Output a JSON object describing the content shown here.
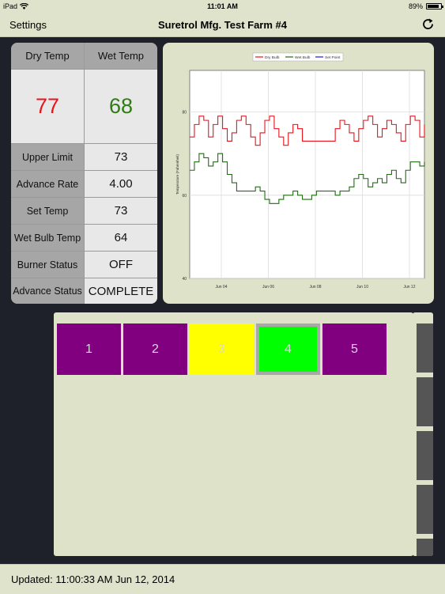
{
  "status_bar": {
    "device": "iPad",
    "time": "11:01 AM",
    "battery": "89%",
    "battery_level": 0.89
  },
  "nav": {
    "settings_label": "Settings",
    "title": "Suretrol Mfg. Test Farm #4"
  },
  "readings": {
    "dry_temp_label": "Dry Temp",
    "wet_temp_label": "Wet Temp",
    "dry_temp_value": "77",
    "wet_temp_value": "68",
    "dry_temp_color": "#e8141b",
    "wet_temp_color": "#2e7d12",
    "rows": [
      {
        "label": "Upper Limit",
        "value": "73"
      },
      {
        "label": "Advance Rate",
        "value": "4.00"
      },
      {
        "label": "Set Temp",
        "value": "73"
      },
      {
        "label": "Wet Bulb Temp",
        "value": "64"
      },
      {
        "label": "Burner Status",
        "value": "OFF"
      },
      {
        "label": "Advance Status",
        "value": "COMPLETE"
      }
    ]
  },
  "chart_data": {
    "type": "line",
    "ylabel": "Temperature (Fahrenheit)",
    "ylim": [
      40,
      90
    ],
    "yticks": [
      "80",
      "60",
      "40"
    ],
    "xticks": [
      "Jun 04",
      "Jun 06",
      "Jun 08",
      "Jun 10",
      "Jun 12"
    ],
    "xlim": [
      0,
      1
    ],
    "legend_position": "top",
    "grid": true,
    "series": [
      {
        "name": "Dry Bulb",
        "color": "#e8141b",
        "x": [
          0,
          0.02,
          0.04,
          0.06,
          0.08,
          0.1,
          0.12,
          0.14,
          0.16,
          0.18,
          0.2,
          0.22,
          0.24,
          0.26,
          0.28,
          0.3,
          0.32,
          0.34,
          0.36,
          0.38,
          0.4,
          0.42,
          0.44,
          0.46,
          0.48,
          0.5,
          0.52,
          0.54,
          0.56,
          0.58,
          0.6,
          0.62,
          0.64,
          0.66,
          0.68,
          0.7,
          0.72,
          0.74,
          0.76,
          0.78,
          0.8,
          0.82,
          0.84,
          0.86,
          0.88,
          0.9,
          0.92,
          0.94,
          0.96,
          0.98,
          1.0
        ],
        "y": [
          74,
          77,
          79,
          78,
          74,
          77,
          79,
          76,
          73,
          75,
          78,
          79,
          77,
          74,
          72,
          75,
          78,
          79,
          76,
          74,
          72,
          75,
          77,
          76,
          73,
          73,
          73,
          73,
          73,
          73,
          73,
          76,
          78,
          77,
          75,
          73,
          76,
          78,
          79,
          77,
          74,
          76,
          78,
          77,
          75,
          73,
          77,
          79,
          78,
          74,
          77
        ]
      },
      {
        "name": "Wet Bulb",
        "color": "#1f6e10",
        "x": [
          0,
          0.02,
          0.04,
          0.06,
          0.08,
          0.1,
          0.12,
          0.14,
          0.16,
          0.18,
          0.2,
          0.22,
          0.24,
          0.26,
          0.28,
          0.3,
          0.32,
          0.34,
          0.36,
          0.38,
          0.4,
          0.42,
          0.44,
          0.46,
          0.48,
          0.5,
          0.52,
          0.54,
          0.56,
          0.58,
          0.6,
          0.62,
          0.64,
          0.66,
          0.68,
          0.7,
          0.72,
          0.74,
          0.76,
          0.78,
          0.8,
          0.82,
          0.84,
          0.86,
          0.88,
          0.9,
          0.92,
          0.94,
          0.96,
          0.98,
          1.0
        ],
        "y": [
          66,
          68,
          70,
          69,
          67,
          68,
          70,
          68,
          65,
          63,
          61,
          61,
          61,
          61,
          62,
          61,
          59,
          58,
          58,
          59,
          60,
          60,
          61,
          60,
          59,
          59,
          60,
          61,
          61,
          61,
          61,
          60,
          61,
          61,
          62,
          64,
          65,
          64,
          62,
          63,
          64,
          63,
          65,
          66,
          64,
          63,
          66,
          68,
          68,
          67,
          68
        ]
      },
      {
        "name": "Set Point",
        "color": "#1a1ad6",
        "x": [],
        "y": []
      }
    ]
  },
  "stations": [
    {
      "label": "1",
      "color": "#800080",
      "selected": false
    },
    {
      "label": "2",
      "color": "#800080",
      "selected": false
    },
    {
      "label": "3",
      "color": "#ffff00",
      "selected": false
    },
    {
      "label": "4",
      "color": "#00ff00",
      "selected": true
    },
    {
      "label": "5",
      "color": "#800080",
      "selected": false
    }
  ],
  "footer": {
    "updated": "Updated: 11:00:33 AM Jun 12, 2014"
  }
}
